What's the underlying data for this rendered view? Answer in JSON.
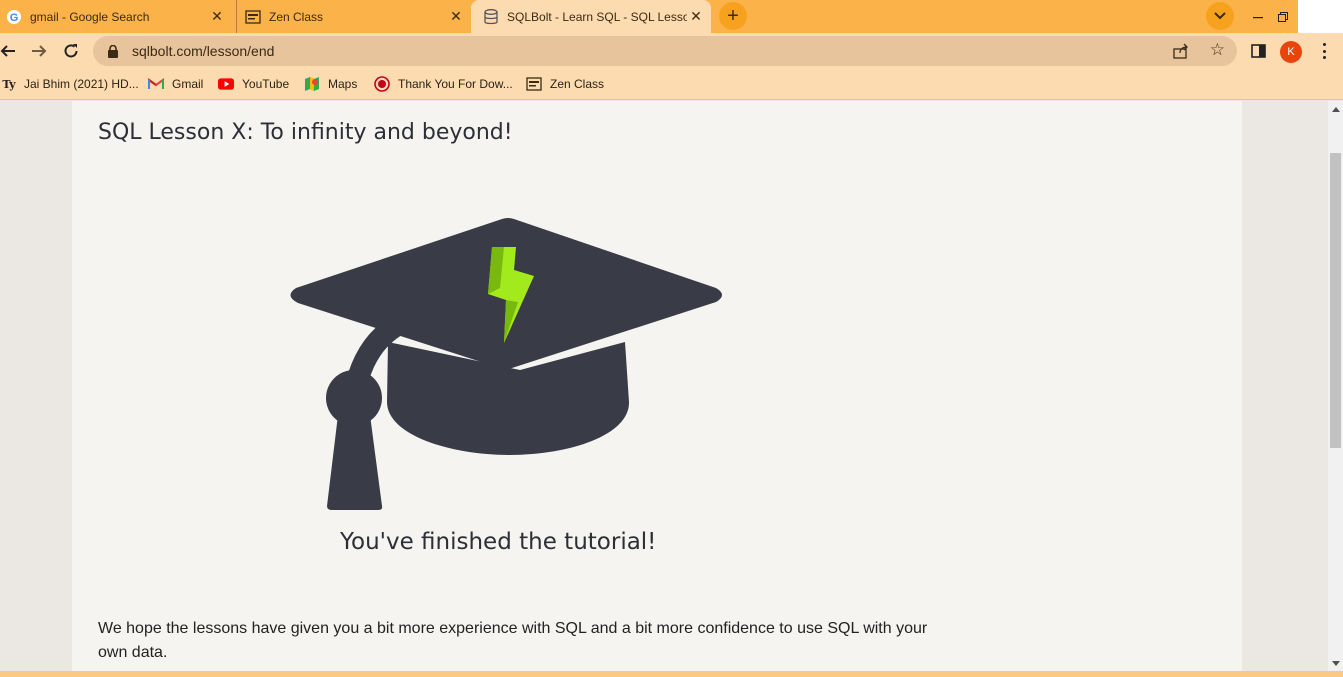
{
  "tabs": [
    {
      "title": "gmail - Google Search",
      "icon": "google-icon",
      "active": false
    },
    {
      "title": "Zen Class",
      "icon": "zen-class-icon",
      "active": false
    },
    {
      "title": "SQLBolt - Learn SQL - SQL Lesson",
      "icon": "database-icon",
      "active": true
    }
  ],
  "toolbar": {
    "url": "sqlbolt.com/lesson/end",
    "avatar_initial": "K"
  },
  "bookmarks": [
    {
      "label": "Jai Bhim (2021) HD...",
      "icon": "ty-icon"
    },
    {
      "label": "Gmail",
      "icon": "gmail-icon"
    },
    {
      "label": "YouTube",
      "icon": "youtube-icon"
    },
    {
      "label": "Maps",
      "icon": "maps-icon"
    },
    {
      "label": "Thank You For Dow...",
      "icon": "record-icon"
    },
    {
      "label": "Zen Class",
      "icon": "zen-class-icon"
    }
  ],
  "page": {
    "lesson_title": "SQL Lesson X: To infinity and beyond!",
    "finished_text": "You've finished the tutorial!",
    "body_text": "We hope the lessons have given you a bit more experience with SQL and a bit more confidence to use SQL with your own data."
  },
  "colors": {
    "tabstrip": "#fbb349",
    "toolbar": "#fddbb0",
    "cap": "#393c46",
    "bolt": "#99e01a"
  }
}
